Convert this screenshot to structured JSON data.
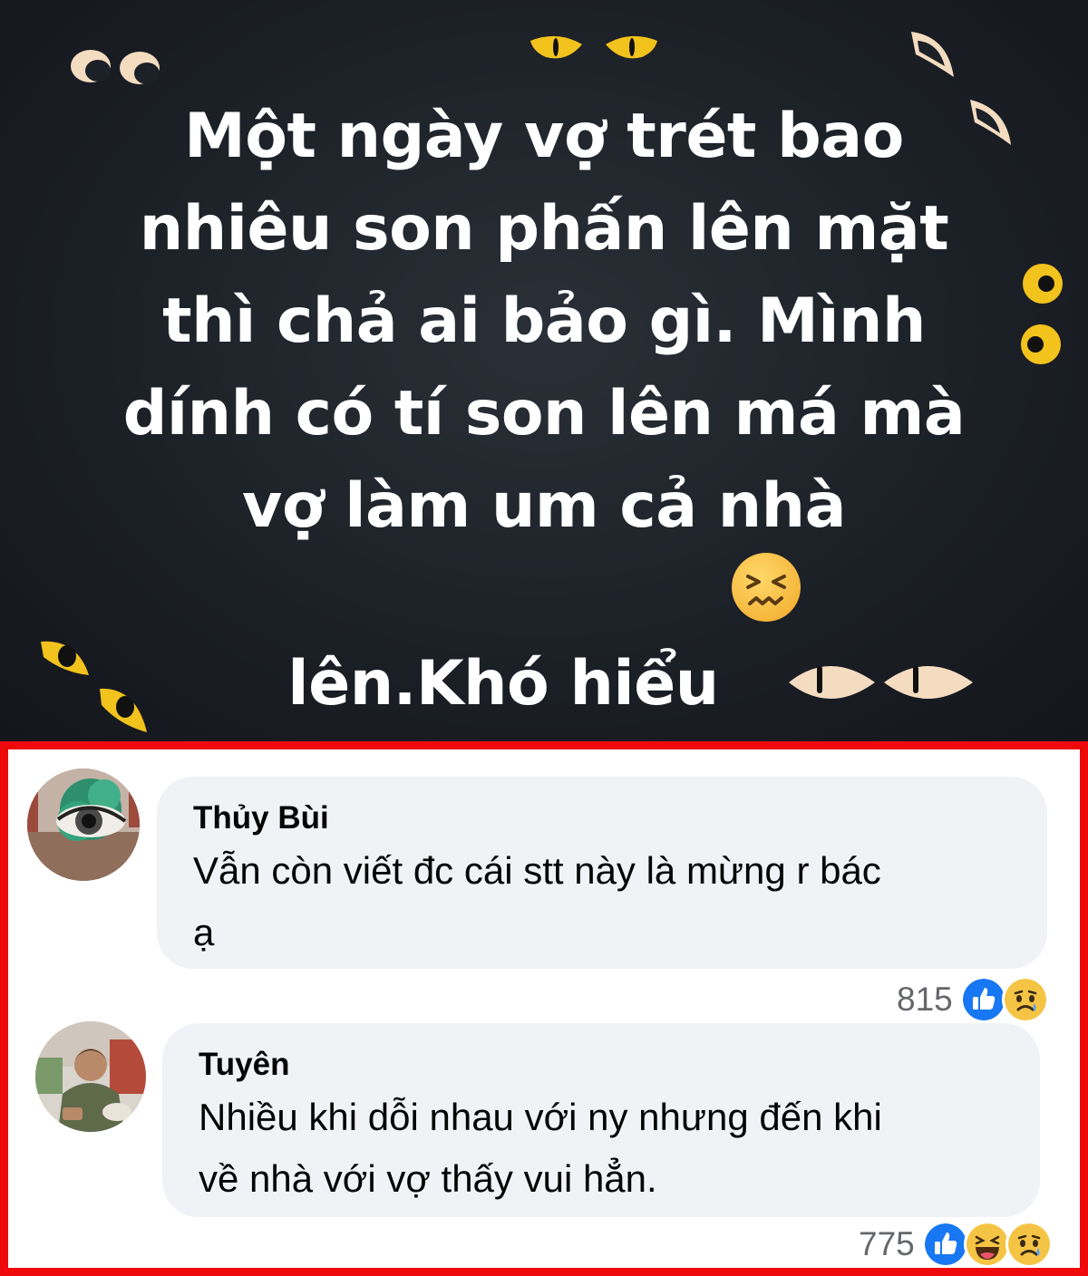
{
  "post": {
    "text": "Một ngày vợ trét bao\nnhiêu son phấn lên mặt\nthì chả ai bảo gì. Mình\ndính có tí son lên má mà\nvợ làm um cả nhà\nlên.Khó hiểu",
    "emoji": "confounded-face"
  },
  "comments": [
    {
      "author": "Thủy Bùi",
      "text": "Vẫn còn viết đc cái stt này là mừng r bác\nạ",
      "reaction_count": "815",
      "reactions": [
        "like",
        "sad"
      ]
    },
    {
      "author": "Tuyên",
      "text": "Nhiều khi dỗi nhau với ny nhưng đến khi\nvề nhà với vợ thấy vui hẳn.",
      "reaction_count": "775",
      "reactions": [
        "like",
        "haha",
        "sad"
      ]
    }
  ],
  "colors": {
    "post_background": "#1c2027",
    "highlight_border": "#ee0a0a",
    "bubble": "#f0f2f5",
    "like_blue": "#1877f2",
    "emoji_yellow": "#f6b73c"
  }
}
